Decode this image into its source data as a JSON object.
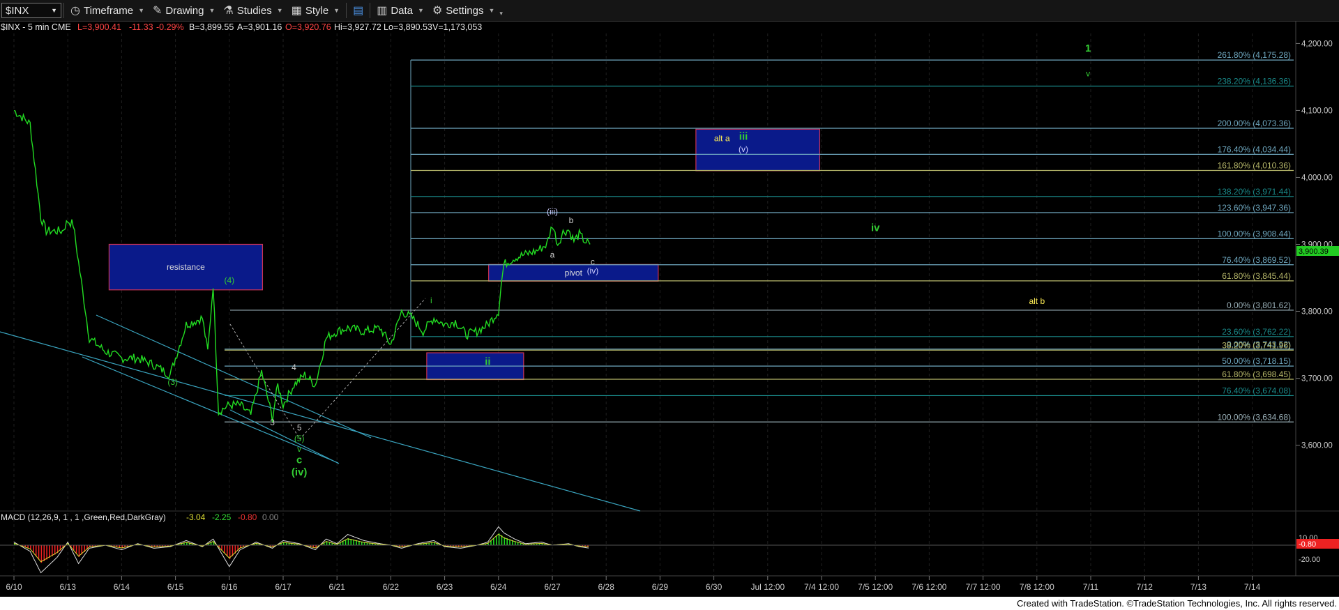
{
  "toolbar": {
    "symbol": "$INX",
    "timeframe": "Timeframe",
    "drawing": "Drawing",
    "studies": "Studies",
    "style": "Style",
    "data": "Data",
    "settings": "Settings",
    "icons": [
      "timeframe-icon",
      "drawing-icon",
      "studies-icon",
      "style-icon",
      "layout-icon",
      "data-icon",
      "gear-icon"
    ]
  },
  "header": {
    "sym": "$INX - 5 min  CME",
    "low": "L=3,900.41",
    "chg": "-11.33",
    "pct": "-0.29%",
    "bid": "B=3,899.55",
    "ask": "A=3,901.16",
    "open": "O=3,920.76",
    "high": "Hi=3,927.72",
    "lo": "Lo=3,890.53",
    "vol": "V=1,173,053"
  },
  "macd": {
    "name": "MACD (12,26,9, 1 , 1 ,Green,Red,DarkGray)",
    "v1": "-3.04",
    "v2": "-2.25",
    "v3": "-0.80",
    "v4": "0.00",
    "axis": [
      "10.00",
      "-20.00"
    ],
    "current": "-0.80"
  },
  "footer": {
    "text": "Created with TradeStation. ©TradeStation Technologies, Inc. All rights reserved."
  },
  "colors": {
    "up": "#22dd22",
    "down": "#ee2222",
    "fib": "#6fa8c0",
    "box": "#0a1a8a",
    "green": "#33cc33",
    "yellow": "#ffee55"
  },
  "chart_data": {
    "type": "line",
    "title": "$INX - 5 min",
    "ylim": [
      3510,
      4215
    ],
    "y_ticks": [
      3600,
      3700,
      3800,
      3900,
      4000,
      4100,
      4200
    ],
    "y_tick_labels": [
      "3,600.00",
      "3,700.00",
      "3,800.00",
      "3,900.00",
      "4,000.00",
      "4,100.00",
      "4,200.00"
    ],
    "last_price": "3,900.39",
    "x_labels": [
      "6/10",
      "6/13",
      "6/14",
      "6/15",
      "6/16",
      "6/17",
      "6/21",
      "6/22",
      "6/23",
      "6/24",
      "6/27",
      "6/28",
      "6/29",
      "6/30",
      "Jul 12:00",
      "7/4 12:00",
      "7/5 12:00",
      "7/6 12:00",
      "7/7 12:00",
      "7/8 12:00",
      "7/11",
      "7/12",
      "7/13",
      "7/14"
    ],
    "price_series": {
      "name": "$INX",
      "x": [
        0,
        0.3,
        0.5,
        0.6,
        0.9,
        1.0,
        1.1,
        1.4,
        1.7,
        2.0,
        2.3,
        2.6,
        2.9,
        3.2,
        3.5,
        3.6,
        3.7,
        3.8,
        4.0,
        4.2,
        4.4,
        4.6,
        4.8,
        4.9,
        5.0,
        5.2,
        5.4,
        5.6,
        5.8,
        6.0,
        6.2,
        6.5,
        6.8,
        7.0,
        7.2,
        7.4,
        7.6,
        7.8,
        8.0,
        8.2,
        8.4,
        8.6,
        8.8,
        9.0,
        9.05,
        9.1,
        9.3,
        9.5,
        9.7,
        9.9,
        10.0,
        10.1,
        10.2,
        10.3,
        10.4,
        10.5,
        10.6,
        10.7
      ],
      "y": [
        4100,
        4080,
        3940,
        3920,
        3920,
        3935,
        3930,
        3760,
        3740,
        3730,
        3730,
        3720,
        3705,
        3780,
        3790,
        3740,
        3840,
        3650,
        3660,
        3660,
        3645,
        3710,
        3640,
        3690,
        3660,
        3690,
        3705,
        3690,
        3760,
        3770,
        3775,
        3770,
        3775,
        3750,
        3800,
        3790,
        3770,
        3790,
        3780,
        3785,
        3765,
        3770,
        3780,
        3800,
        3840,
        3870,
        3880,
        3885,
        3890,
        3900,
        3930,
        3900,
        3918,
        3922,
        3905,
        3915,
        3905,
        3900
      ]
    },
    "macd_series": {
      "name": "MACD",
      "x": [
        0,
        0.3,
        0.5,
        0.8,
        1.0,
        1.2,
        1.4,
        1.7,
        2.0,
        2.3,
        2.6,
        2.9,
        3.2,
        3.5,
        3.7,
        4.0,
        4.2,
        4.5,
        4.8,
        5.0,
        5.3,
        5.6,
        5.8,
        6.0,
        6.2,
        6.5,
        6.8,
        7.0,
        7.2,
        7.5,
        7.8,
        8.0,
        8.3,
        8.6,
        8.8,
        9.0,
        9.1,
        9.3,
        9.5,
        9.8,
        10.0,
        10.3,
        10.5,
        10.7
      ],
      "y": [
        2,
        -4,
        -18,
        -8,
        2,
        -12,
        -2,
        0,
        -3,
        1,
        -2,
        -1,
        3,
        -1,
        4,
        -14,
        -3,
        2,
        -2,
        3,
        1,
        -3,
        4,
        1,
        7,
        3,
        1,
        0,
        -2,
        1,
        3,
        -1,
        -2,
        0,
        2,
        12,
        8,
        4,
        1,
        2,
        0,
        1,
        -1,
        -2
      ]
    },
    "fib_levels": [
      {
        "label": "261.80% (4,175.28)",
        "value": 4175.28,
        "color": "#6fa8c0"
      },
      {
        "label": "238.20% (4,136.36)",
        "value": 4136.36,
        "color": "#1a8a8a"
      },
      {
        "label": "200.00% (4,073.36)",
        "value": 4073.36,
        "color": "#6fa8c0"
      },
      {
        "label": "176.40% (4,034.44)",
        "value": 4034.44,
        "color": "#6fa8c0"
      },
      {
        "label": "161.80% (4,010.36)",
        "value": 4010.36,
        "color": "#b7b86a"
      },
      {
        "label": "138.20% (3,971.44)",
        "value": 3971.44,
        "color": "#1a8a8a"
      },
      {
        "label": "123.60% (3,947.36)",
        "value": 3947.36,
        "color": "#6fa8c0"
      },
      {
        "label": "100.00% (3,908.44)",
        "value": 3908.44,
        "color": "#6fa8c0"
      },
      {
        "label": "76.40% (3,869.52)",
        "value": 3869.52,
        "color": "#6fa8c0"
      },
      {
        "label": "61.80% (3,845.44)",
        "value": 3845.44,
        "color": "#b7b86a"
      },
      {
        "label": "0.00% (3,801.62)",
        "value": 3801.62,
        "color": "#9ab0b8"
      },
      {
        "label": "23.60% (3,762.22)",
        "value": 3762.22,
        "color": "#1a8a8a"
      },
      {
        "label": "0.00% (3,743.52)",
        "value": 3743.52,
        "color": "#6fa8c0"
      },
      {
        "label": "38.20% (3,741.96)",
        "value": 3741.96,
        "color": "#b7b86a"
      },
      {
        "label": "50.00% (3,718.15)",
        "value": 3718.15,
        "color": "#6fa8c0"
      },
      {
        "label": "61.80% (3,698.45)",
        "value": 3698.45,
        "color": "#b7b86a"
      },
      {
        "label": "76.40% (3,674.08)",
        "value": 3674.08,
        "color": "#1a8a8a"
      },
      {
        "label": "100.00% (3,634.68)",
        "value": 3634.68,
        "color": "#9ab0b8"
      }
    ],
    "zones": [
      {
        "label": "resistance",
        "x0": 2.0,
        "x1": 4.85,
        "y0": 3832,
        "y1": 3900,
        "border": "#cc3355"
      },
      {
        "label": "",
        "x0": 7.9,
        "x1": 9.7,
        "y0": 3698,
        "y1": 3738,
        "border": "#cc3355"
      },
      {
        "label": "pivot",
        "x0": 9.05,
        "x1": 12.2,
        "y0": 3845,
        "y1": 3870,
        "border": "#cc3355"
      },
      {
        "label": "",
        "x0": 12.9,
        "x1": 15.2,
        "y0": 4010,
        "y1": 4072,
        "border": "#cc3355"
      }
    ],
    "annotations": [
      {
        "text": "(4)",
        "x": 4.0,
        "y": 3842,
        "color": "#33cc33"
      },
      {
        "text": "(3)",
        "x": 2.95,
        "y": 3690,
        "color": "#33cc33"
      },
      {
        "text": "4",
        "x": 5.2,
        "y": 3712,
        "color": "#cccccc"
      },
      {
        "text": "3",
        "x": 4.8,
        "y": 3630,
        "color": "#cccccc"
      },
      {
        "text": "5",
        "x": 5.3,
        "y": 3622,
        "color": "#cccccc"
      },
      {
        "text": "(5)",
        "x": 5.3,
        "y": 3606,
        "color": "#33cc33"
      },
      {
        "text": "v",
        "x": 5.3,
        "y": 3590,
        "color": "#33cc33"
      },
      {
        "text": "c",
        "x": 5.3,
        "y": 3573,
        "color": "#33cc33"
      },
      {
        "text": "(iv)",
        "x": 5.3,
        "y": 3555,
        "color": "#33cc33"
      },
      {
        "text": "i",
        "x": 7.75,
        "y": 3812,
        "color": "#33cc33"
      },
      {
        "text": "ii",
        "x": 8.8,
        "y": 3720,
        "color": "#33cc33"
      },
      {
        "text": "(iii)",
        "x": 10.0,
        "y": 3945,
        "color": "#ccccff"
      },
      {
        "text": "b",
        "x": 10.35,
        "y": 3932,
        "color": "#cccccc"
      },
      {
        "text": "a",
        "x": 10.0,
        "y": 3880,
        "color": "#cccccc"
      },
      {
        "text": "c",
        "x": 10.75,
        "y": 3870,
        "color": "#cccccc"
      },
      {
        "text": "(iv)",
        "x": 10.75,
        "y": 3856,
        "color": "#ccccff"
      },
      {
        "text": "alt a",
        "x": 13.15,
        "y": 4054,
        "color": "#ffee55"
      },
      {
        "text": "iii",
        "x": 13.55,
        "y": 4056,
        "color": "#33cc33"
      },
      {
        "text": "(v)",
        "x": 13.55,
        "y": 4038,
        "color": "#ccccff"
      },
      {
        "text": "iv",
        "x": 16.0,
        "y": 3920,
        "color": "#33cc33"
      },
      {
        "text": "alt b",
        "x": 19.0,
        "y": 3811,
        "color": "#ffee55"
      },
      {
        "text": "1",
        "x": 19.95,
        "y": 4188,
        "color": "#33cc33"
      },
      {
        "text": "v",
        "x": 19.95,
        "y": 4151,
        "color": "#33cc33"
      }
    ]
  }
}
